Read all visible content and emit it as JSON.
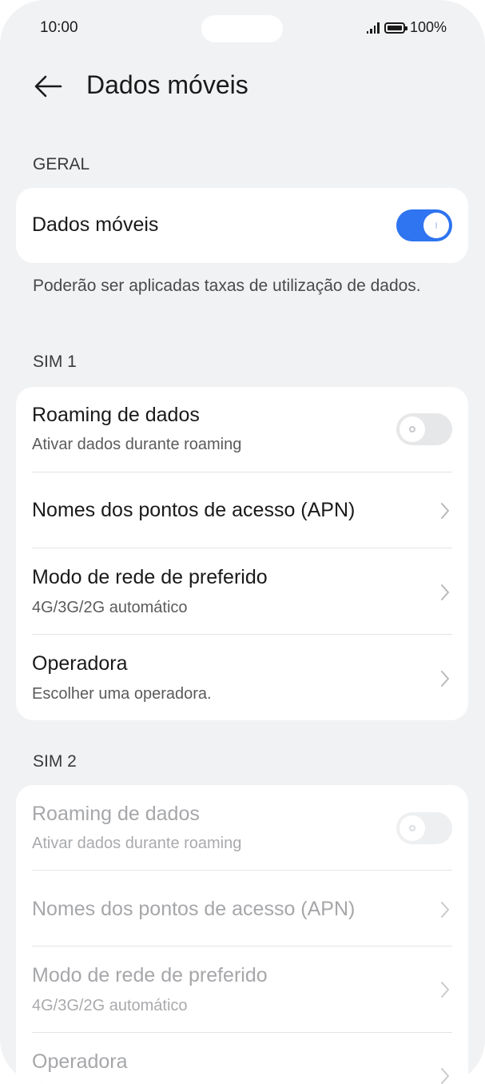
{
  "status": {
    "time": "10:00",
    "battery": "100%"
  },
  "header": {
    "title": "Dados móveis"
  },
  "general": {
    "label": "GERAL",
    "mobile_data": {
      "title": "Dados móveis",
      "enabled": true
    },
    "note": "Poderão ser aplicadas taxas de utilização de dados."
  },
  "sim1": {
    "label": "SIM 1",
    "roaming": {
      "title": "Roaming de dados",
      "subtitle": "Ativar dados durante roaming",
      "enabled": false
    },
    "apn": {
      "title": "Nomes dos pontos de acesso (APN)"
    },
    "network_mode": {
      "title": "Modo de rede de preferido",
      "subtitle": "4G/3G/2G automático"
    },
    "operator": {
      "title": "Operadora",
      "subtitle": "Escolher uma operadora."
    }
  },
  "sim2": {
    "label": "SIM 2",
    "roaming": {
      "title": "Roaming de dados",
      "subtitle": "Ativar dados durante roaming",
      "enabled": false
    },
    "apn": {
      "title": "Nomes dos pontos de acesso (APN)"
    },
    "network_mode": {
      "title": "Modo de rede de preferido",
      "subtitle": "4G/3G/2G automático"
    },
    "operator": {
      "title": "Operadora"
    }
  },
  "colors": {
    "accent": "#2f74f0",
    "background": "#f1f2f4",
    "card": "#ffffff"
  }
}
